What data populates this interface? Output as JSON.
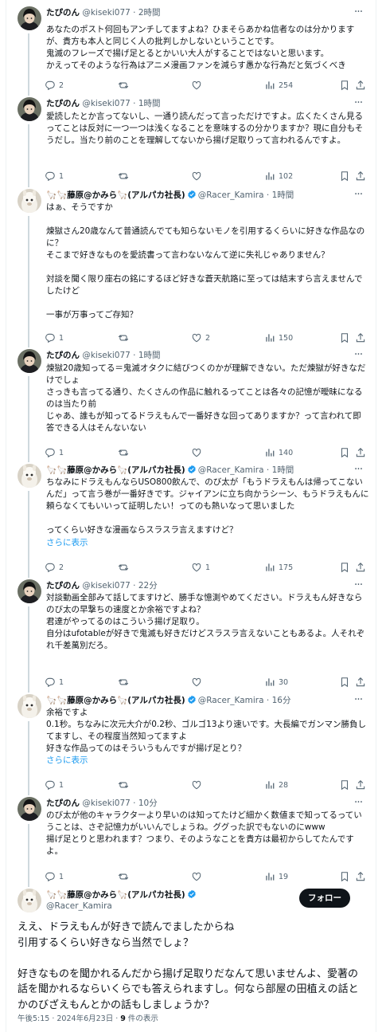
{
  "icons": {
    "reply": "reply-icon",
    "retweet": "retweet-icon",
    "like": "like-icon",
    "views": "views-icon",
    "bookmark": "bookmark-icon",
    "share": "share-icon",
    "more": "more-icon",
    "verified": "verified-badge-icon"
  },
  "colors": {
    "accent": "#1d9bf0",
    "text": "#0f1419",
    "muted": "#536471",
    "divider": "#eff3f4",
    "verified": "#1d9bf0"
  },
  "replies": [
    {
      "name": "たぴのん",
      "handle": "@kiseki077",
      "time": "2時間",
      "text": "あなたのポスト何回もアンチしてますよね？ひまそらあかね信者なのは分かりますが、貴方も本人と同じく人の批判しかしないということです。\n鬼滅のフレーズで揚げ足とるとかいい大人がすることではないと思います。\nかえってそのような行為はアニメ漫画ファンを減らす愚かな行為だと気づくべき",
      "stats": {
        "replies": "2",
        "retweets": "",
        "likes": "",
        "views": "254"
      }
    },
    {
      "name": "たぴのん",
      "handle": "@kiseki077",
      "time": "1時間",
      "text": "愛読したとか言ってないし、一通り読んだって言っただけですよ。広くたくさん見るってことは反対に一つ一つは浅くなることを意味するの分かりますか？現に自分もそうだし。当たり前のことを理解してないから揚げ足取りって言われるんですよ。",
      "stats": {
        "replies": "1",
        "retweets": "",
        "likes": "",
        "views": "102"
      }
    },
    {
      "name": "🦙🦙藤原@かみら🦙(アルパカ社長)",
      "handle": "@Racer_Kamira",
      "time": "1時間",
      "text": "はぁ、そうですか\n\n煉獄さん20歳なんて普通読んでても知らないモノを引用するくらいに好きな作品なのに？\nそこまで好きなものを愛読書って言わないなんて逆に失礼じゃありません？\n\n対談を聞く限り座右の銘にするほど好きな蒼天航路に至っては結末すら言えませんでしたけど\n\n一事が万事ってご存知？",
      "stats": {
        "replies": "1",
        "retweets": "",
        "likes": "2",
        "views": "150"
      }
    },
    {
      "name": "たぴのん",
      "handle": "@kiseki077",
      "time": "1時間",
      "text": "煉獄20歳知ってる＝鬼滅オタクに結びつくのかが理解できない。ただ煉獄が好きなだけでしょ\nさっきも言ってる通り、たくさんの作品に触れるってことは各々の記憶が曖昧になるのは当たり前\nじゃあ、誰もが知ってるドラえもんで一番好きな回ってありますか？って言われて即答できる人はそんないない",
      "stats": {
        "replies": "1",
        "retweets": "",
        "likes": "",
        "views": "140"
      }
    },
    {
      "name": "🦙🦙藤原@かみら🦙(アルパカ社長)",
      "handle": "@Racer_Kamira",
      "time": "1時間",
      "text": "ちなみにドラえもんならUSO800飲んで、のび太が「もうドラえもんは帰ってこないんだ」って言う巻が一番好きです。ジャイアンに立ち向かうシーン、もうドラえもんに頼らなくてもいいって証明したい！ってのも熱いなって思いました\n\nってくらい好きな漫画ならスラスラ言えますけど？",
      "show_more": "さらに表示",
      "stats": {
        "replies": "2",
        "retweets": "",
        "likes": "1",
        "views": "175"
      }
    },
    {
      "name": "たぴのん",
      "handle": "@kiseki077",
      "time": "22分",
      "text": "対談動画全部みて話してますけど、勝手な憶測やめてください。ドラえもん好きなら\nのび太の早撃ちの速度とか余裕ですよね？\n君達がやってるのはこういう揚げ足取り。\n自分はufotableが好きで鬼滅も好きだけどスラスラ言えないこともあるよ。人それぞれ千差萬別だろ。",
      "stats": {
        "replies": "1",
        "retweets": "",
        "likes": "",
        "views": "30"
      }
    },
    {
      "name": "🦙🦙藤原@かみら🦙(アルパカ社長)",
      "handle": "@Racer_Kamira",
      "time": "16分",
      "text": "余裕ですよ\n0.1秒。ちなみに次元大介が0.2秒、ゴルゴ13より速いです。大長編でガンマン勝負してますし、その程度当然知ってますよ\n好きな作品ってのはそういうもんですが揚げ足とり？",
      "show_more": "さらに表示",
      "stats": {
        "replies": "1",
        "retweets": "",
        "likes": "",
        "views": "28"
      }
    },
    {
      "name": "たぴのん",
      "handle": "@kiseki077",
      "time": "10分",
      "text": "のび太が他のキャラクターより早いのは知ってたけど細かく数値まで知ってるっていうことは、さぞ記憶力がいいんでしょうね。ググった訳でもないのにwww\n揚げ足とりと思われます？つまり、そのようなことを貴方は最初からしてたんですよ。",
      "stats": {
        "replies": "1",
        "retweets": "",
        "likes": "",
        "views": "19"
      }
    }
  ],
  "main": {
    "name": "🦙🦙藤原@かみら🦙(アルパカ社長)",
    "handle": "@Racer_Kamira",
    "follow_label": "フォロー",
    "text": "ええ、ドラえもんが好きで読んでましたからね\n引用するくらい好きなら当然でしょ？\n\n好きなものを聞かれるんだから揚げ足取りだなんて思いませんよ、愛著の話を聞かれるならいくらでも答えられますし。何なら部屋の田植えの話とかのびざえもんとかの話もしましょうか？",
    "time": "午後5:15 · 2024年6月23日",
    "separator": " · ",
    "view_count": "9",
    "view_label": " 件の表示"
  }
}
